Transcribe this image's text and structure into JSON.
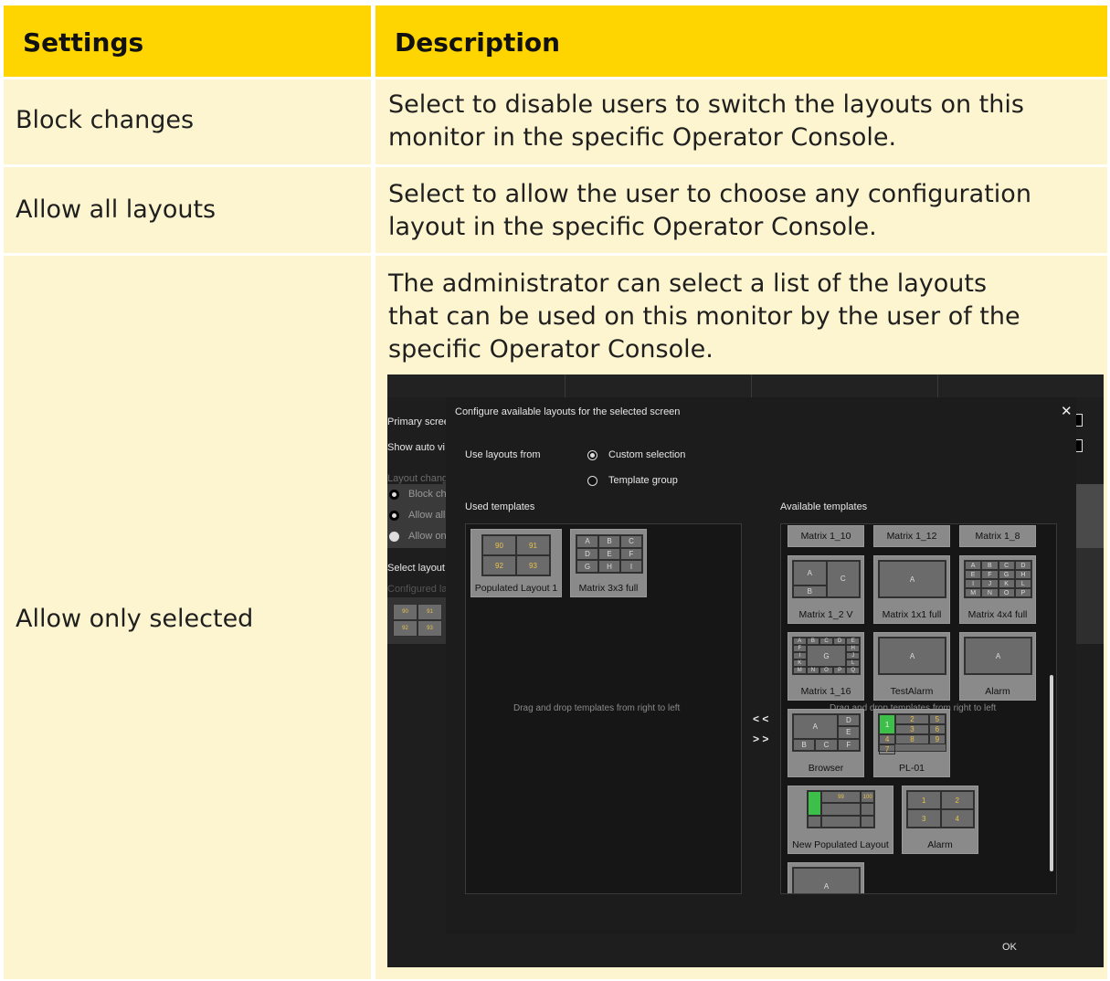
{
  "table": {
    "headers": {
      "settings": "Settings",
      "description": "Description"
    },
    "rows": [
      {
        "setting": "Block changes",
        "description": [
          "Select to disable users to switch the layouts on this",
          "monitor in the specific Operator Console."
        ]
      },
      {
        "setting": "Allow all layouts",
        "description": [
          "Select to allow the user to choose any configuration",
          "layout in the specific Operator Console."
        ]
      },
      {
        "setting": "Allow only selected",
        "description": [
          "The administrator can select a list of the layouts",
          "that can be used on this monitor by the user of the",
          "specific Operator Console."
        ]
      }
    ]
  },
  "screenshot": {
    "background": {
      "primary_screen": "Primary scree",
      "show_auto": "Show auto vi",
      "layout_change": "Layout chang",
      "block": "Block ch",
      "allow_all": "Allow all",
      "allow_only": "Allow on",
      "select_layout": "Select layout",
      "configured": "Configured la",
      "mini_cells": [
        "90",
        "91",
        "92",
        "93"
      ]
    },
    "dialog": {
      "title": "Configure available layouts for the selected screen",
      "close": "✕",
      "use_layouts_from": "Use layouts from",
      "custom_selection": "Custom selection",
      "template_group": "Template group",
      "used_templates": "Used templates",
      "available_templates": "Available templates",
      "drag_hint": "Drag and drop templates from right to left",
      "move_left": "< <",
      "move_right": "> >",
      "ok": "OK",
      "used": [
        {
          "label": "Populated Layout 1",
          "cells": [
            "90",
            "91",
            "92",
            "93"
          ]
        },
        {
          "label": "Matrix 3x3 full",
          "cells": [
            "A",
            "B",
            "C",
            "D",
            "E",
            "F",
            "G",
            "H",
            "I"
          ]
        }
      ],
      "available": [
        {
          "label": "Matrix 1_10"
        },
        {
          "label": "Matrix 1_12"
        },
        {
          "label": "Matrix 1_8"
        },
        {
          "label": "Matrix 1_2 V",
          "cells": [
            "A",
            "C",
            "B"
          ]
        },
        {
          "label": "Matrix 1x1 full",
          "cells": [
            "A"
          ]
        },
        {
          "label": "Matrix 4x4 full",
          "cells": [
            "A",
            "B",
            "C",
            "D",
            "E",
            "F",
            "G",
            "H",
            "I",
            "J",
            "K",
            "L",
            "M",
            "N",
            "O",
            "P"
          ]
        },
        {
          "label": "Matrix 1_16",
          "cells": [
            "A",
            "B",
            "C",
            "D",
            "E",
            "F",
            "G",
            "H",
            "I",
            "J",
            "K",
            "L",
            "M",
            "N",
            "O",
            "P",
            "Q"
          ]
        },
        {
          "label": "TestAlarm",
          "cells": [
            "A"
          ]
        },
        {
          "label": "Alarm",
          "cells": [
            "A"
          ]
        },
        {
          "label": "Browser",
          "cells": [
            "A",
            "D",
            "E",
            "B",
            "C",
            "F"
          ]
        },
        {
          "label": "PL-01",
          "cells": [
            "2",
            "1",
            "5",
            "3",
            "6",
            "4",
            "8",
            "9",
            "7"
          ]
        },
        {
          "label": "New Populated Layout",
          "cells": [
            "99",
            "100"
          ]
        },
        {
          "label": "Alarm",
          "cells": [
            "1",
            "2",
            "3",
            "4"
          ]
        },
        {
          "label": "",
          "cells": [
            "A"
          ]
        }
      ]
    }
  },
  "colors": {
    "header": "#fed501",
    "cell": "#fdf5cf",
    "green": "#3cc04a"
  }
}
